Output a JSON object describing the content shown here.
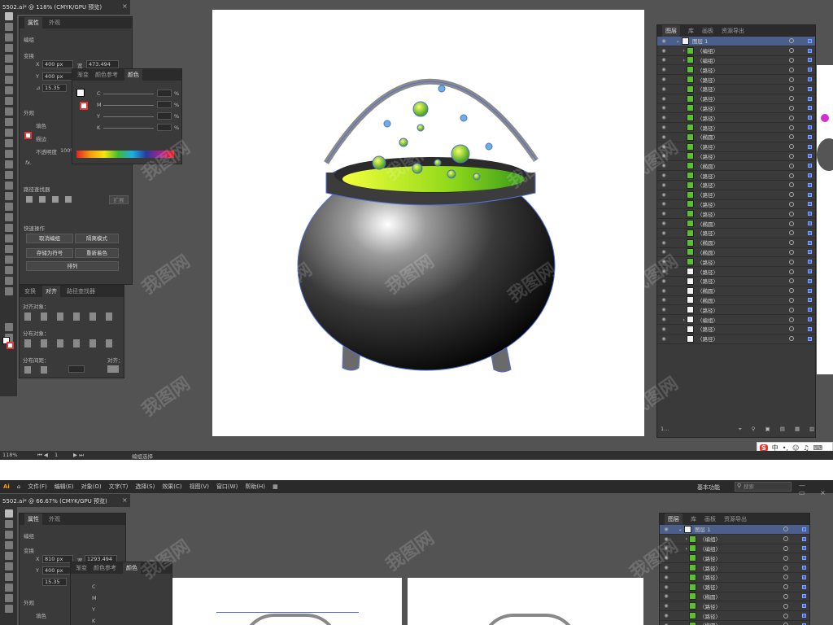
{
  "doc1": {
    "title": "5502.ai* @ 118% (CMYK/GPU 预览)",
    "zoom": "118%",
    "status_text": "编组选择",
    "artboard_num": "1"
  },
  "doc2": {
    "title": "5502.ai* @ 66.67% (CMYK/GPU 预览)",
    "zoom": "66.67%"
  },
  "menu": {
    "logo": "Ai",
    "items": [
      "文件(F)",
      "编辑(E)",
      "对象(O)",
      "文字(T)",
      "选择(S)",
      "效果(C)",
      "视图(V)",
      "窗口(W)",
      "帮助(H)"
    ],
    "workspace": "基本功能",
    "search_placeholder": "搜索"
  },
  "props_panel": {
    "tabs": [
      "属性",
      "外观"
    ],
    "group_label": "编组",
    "transform_label": "变换",
    "x_label": "X",
    "x_value_1": "400 px",
    "x_value_2": "810 px",
    "w_label": "宽",
    "w_value_1": "473.494",
    "w_value_2": "1293.494",
    "y_label": "Y",
    "y_value": "400 px",
    "angle_value": "15.35",
    "appearance_label": "外观",
    "fill_label": "填色",
    "stroke_label": "描边",
    "opacity_label": "不透明度",
    "opacity_value": "100%",
    "fx_label": "fx.",
    "pathfinder_label": "路径查找器",
    "expand_label": "扩展",
    "quick_actions_label": "快速操作",
    "btn_ungroup": "取消编组",
    "btn_isolate": "隔离模式",
    "btn_save_symbol": "存储为符号",
    "btn_recolor": "重新着色",
    "btn_arrange": "排列"
  },
  "color_panel": {
    "tabs": [
      "渐变",
      "颜色参考",
      "颜色"
    ],
    "channels": [
      "C",
      "M",
      "Y",
      "K"
    ],
    "percent": "%"
  },
  "align_panel": {
    "tabs": [
      "变换",
      "对齐",
      "路径查找器"
    ],
    "align_objects": "对齐对象：",
    "distribute_objects": "分布对象：",
    "distribute_spacing": "分布间距：",
    "align_to": "对齐："
  },
  "layers_panel": {
    "tabs": [
      "图层",
      "库",
      "画板",
      "资源导出"
    ],
    "layer_name": "图层 1",
    "rows": [
      "〈编组〉",
      "〈编组〉",
      "〈路径〉",
      "〈路径〉",
      "〈路径〉",
      "〈路径〉",
      "〈路径〉",
      "〈路径〉",
      "〈路径〉",
      "〈椭圆〉",
      "〈路径〉",
      "〈路径〉",
      "〈椭圆〉",
      "〈路径〉",
      "〈路径〉",
      "〈路径〉",
      "〈路径〉",
      "〈路径〉",
      "〈椭圆〉",
      "〈路径〉",
      "〈椭圆〉",
      "〈椭圆〉",
      "〈路径〉",
      "〈路径〉",
      "〈路径〉",
      "〈椭圆〉",
      "〈椭圆〉",
      "〈路径〉",
      "〈编组〉",
      "〈路径〉",
      "〈路径〉"
    ],
    "footer": "1..."
  },
  "layers_panel_2": {
    "rows": [
      "〈编组〉",
      "〈编组〉",
      "〈路径〉",
      "〈路径〉",
      "〈路径〉",
      "〈路径〉",
      "〈椭圆〉",
      "〈路径〉",
      "〈路径〉",
      "〈椭圆〉"
    ]
  },
  "watermark": "我图网",
  "colors": {
    "ui_bg": "#535353",
    "panel_bg": "#3a3a3a",
    "selection": "#4a78e0",
    "potion": "#9ae01a",
    "cauldron": "#1a1a1a"
  }
}
